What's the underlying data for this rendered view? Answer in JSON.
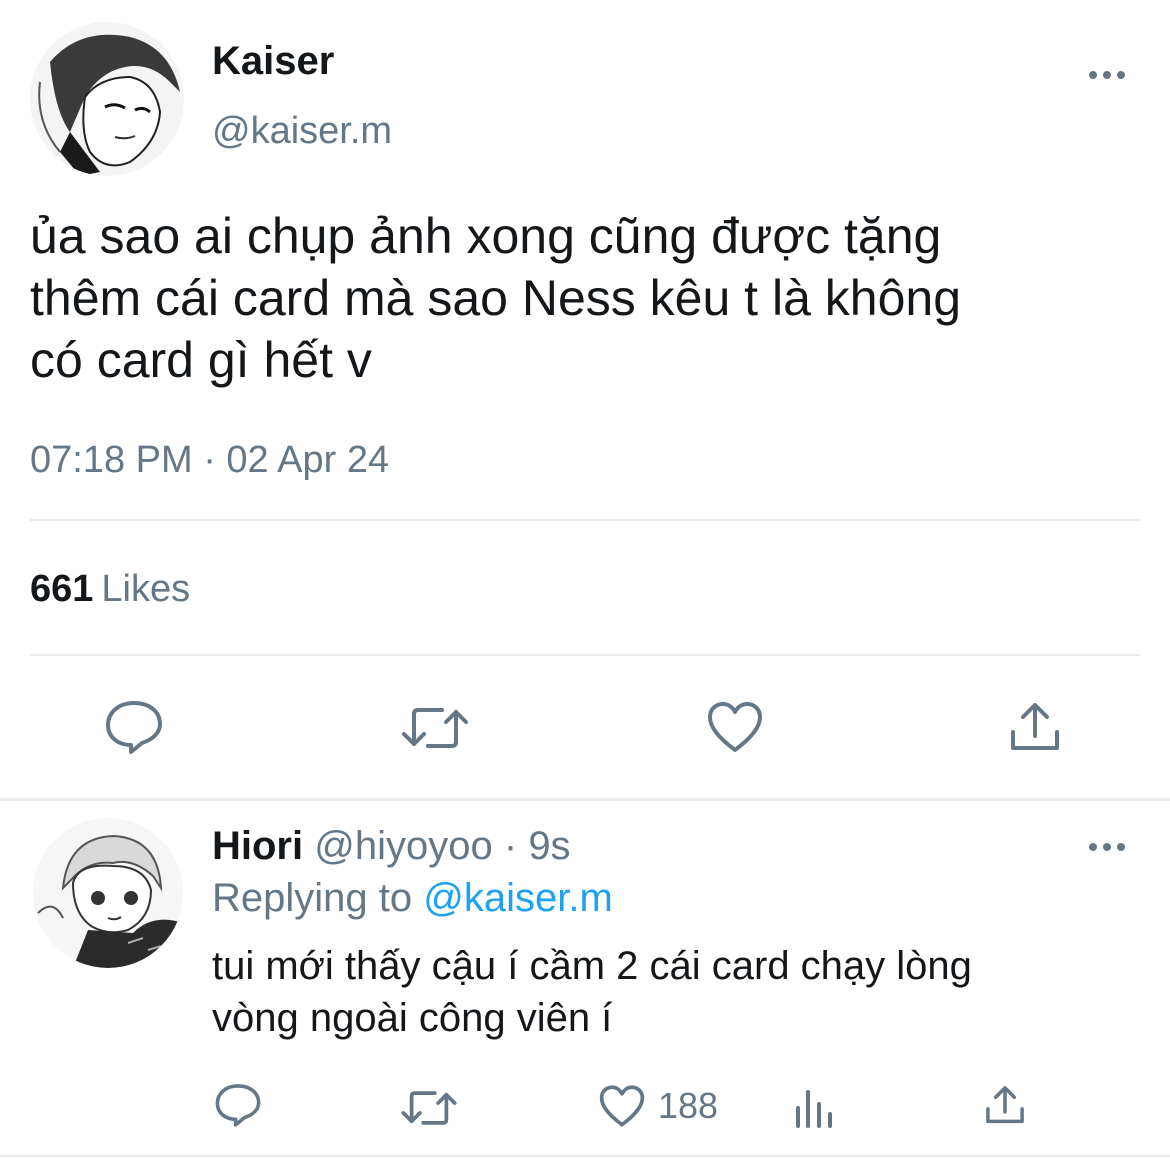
{
  "tweet": {
    "author_name": "Kaiser",
    "author_handle": "@kaiser.m",
    "text": "ủa sao ai chụp ảnh xong cũng được tặng\nthêm cái card mà sao Ness kêu t là không\ncó card gì hết v",
    "timestamp": "07:18 PM · 02 Apr 24",
    "likes_count": "661",
    "likes_label": "Likes",
    "actions": [
      "reply-icon",
      "retweet-icon",
      "like-icon",
      "share-icon"
    ]
  },
  "reply": {
    "author_name": "Hiori",
    "author_handle": "@hiyoyoo",
    "separator": "·",
    "time": "9s",
    "replying_prefix": "Replying to",
    "replying_handle": "@kaiser.m",
    "text": "tui mới thấy cậu í cầm 2 cái card chạy lòng\nvòng ngoài công viên í",
    "likes_count": "188",
    "actions": [
      "reply-icon",
      "retweet-icon",
      "like-icon",
      "analytics-icon",
      "share-icon"
    ]
  },
  "colors": {
    "text_primary": "#14171a",
    "text_secondary": "#657786",
    "link": "#1da1f2",
    "divider": "#e6ecf0"
  }
}
